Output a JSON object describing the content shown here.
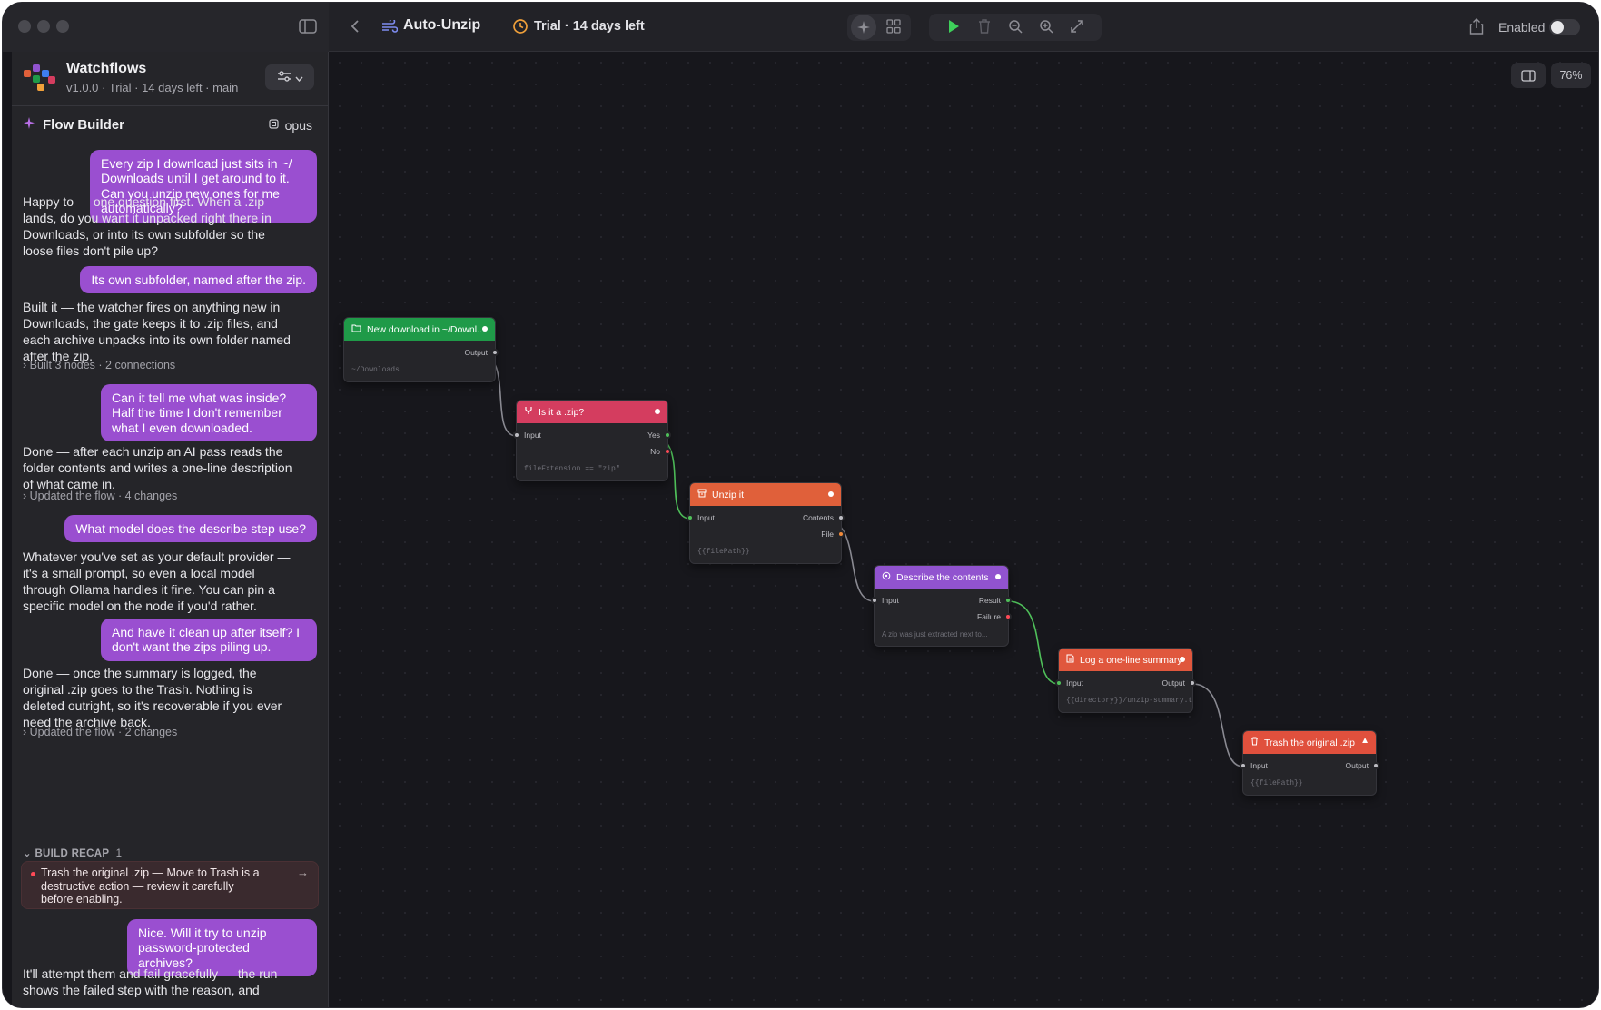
{
  "titlebar": {
    "flow_name": "Auto-Unzip",
    "trial": "Trial · 14 days left",
    "enabled_label": "Enabled"
  },
  "app": {
    "name": "Watchflows",
    "meta": "v1.0.0 · Trial · 14 days left · main"
  },
  "flow_builder": {
    "title": "Flow Builder",
    "model": "opus"
  },
  "chat": {
    "u1": "Every zip I download just sits in ~/ Downloads until I get around to it. Can you unzip new ones for me automatically?",
    "a1": "Happy to — one question first. When a .zip lands, do you want it unpacked right there in Downloads, or into its own subfolder so the loose files don't pile up?",
    "u2": "Its own subfolder, named after the zip.",
    "a2": "Built it — the watcher fires on anything new in Downloads, the gate keeps it to .zip files, and each archive unpacks into its own folder named after the zip.",
    "s2": "Built 3 nodes · 2 connections",
    "u3": "Can it tell me what was inside? Half the time I don't remember what I even downloaded.",
    "a3": "Done — after each unzip an AI pass reads the folder contents and writes a one-line description of what came in.",
    "s3": "Updated the flow · 4 changes",
    "u4": "What model does the describe step use?",
    "a4": "Whatever you've set as your default provider — it's a small prompt, so even a local model through Ollama handles it fine. You can pin a specific model on the node if you'd rather.",
    "u5": "And have it clean up after itself? I don't want the zips piling up.",
    "a5": "Done — once the summary is logged, the original .zip goes to the Trash. Nothing is deleted outright, so it's recoverable if you ever need the archive back.",
    "s5": "Updated the flow · 2 changes",
    "recap_label": "BUILD RECAP",
    "recap_count": "1",
    "recap_text": "Trash the original .zip — Move to Trash is a destructive action — review it carefully before enabling.",
    "u6": "Nice. Will it try to unzip password-protected archives?",
    "a6": "It'll attempt them and fail gracefully — the run shows the failed step with the reason, and"
  },
  "canvas": {
    "zoom": "76%"
  },
  "nodes": {
    "n1": {
      "title": "New download in ~/Downl...",
      "out1": "Output",
      "foot": "~/Downloads",
      "color": "#1f9a48"
    },
    "n2": {
      "title": "Is it a .zip?",
      "in1": "Input",
      "out1": "Yes",
      "out2": "No",
      "foot": "fileExtension == \"zip\"",
      "color": "#d43d5f"
    },
    "n3": {
      "title": "Unzip it",
      "in1": "Input",
      "out1": "Contents",
      "out2": "File",
      "foot": "{{filePath}}",
      "color": "#e0603a"
    },
    "n4": {
      "title": "Describe the contents",
      "in1": "Input",
      "out1": "Result",
      "out2": "Failure",
      "foot": "A zip was just extracted next to...",
      "color": "#9153cf"
    },
    "n5": {
      "title": "Log a one-line summary",
      "in1": "Input",
      "out1": "Output",
      "foot": "{{directory}}/unzip-summary.txt",
      "color": "#e0573d"
    },
    "n6": {
      "title": "Trash the original .zip",
      "in1": "Input",
      "out1": "Output",
      "foot": "{{filePath}}",
      "color": "#e0503d"
    }
  },
  "colors": {
    "accent": "#9a4fd0",
    "success_edge": "#4fc05a",
    "edge": "#8a8a92",
    "error": "#ff4a57"
  }
}
